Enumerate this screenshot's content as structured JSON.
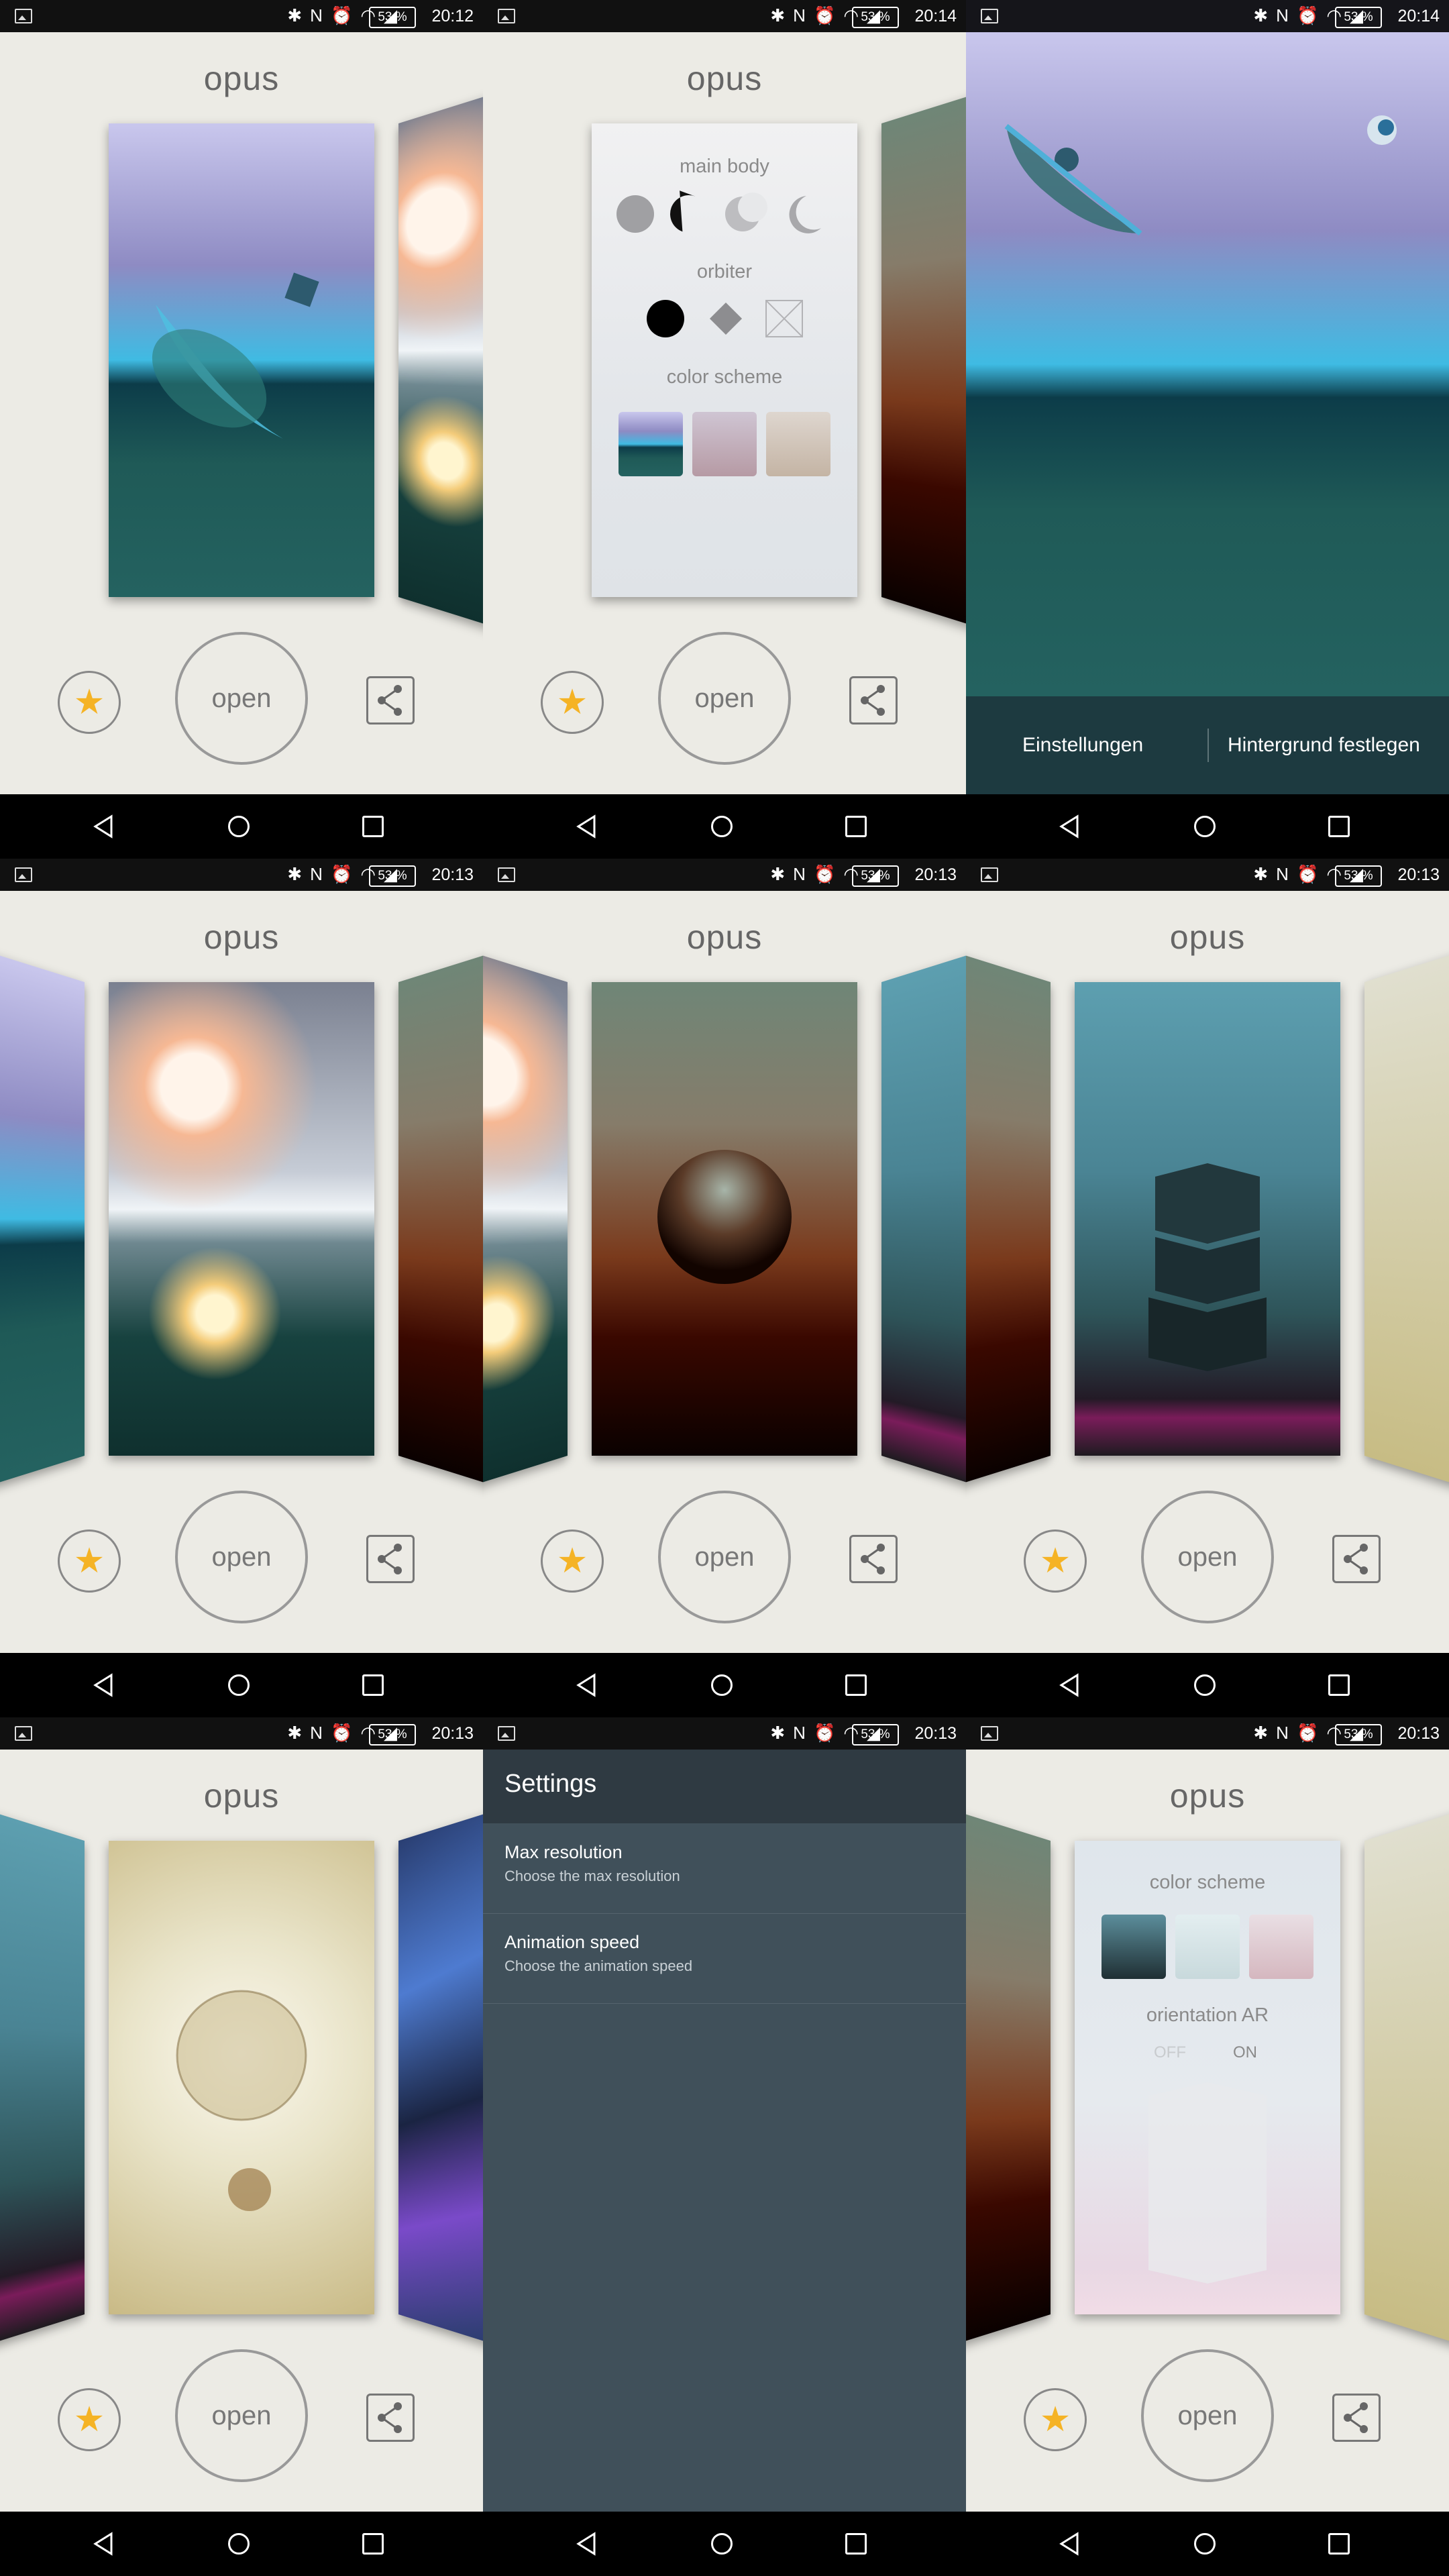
{
  "status": {
    "battery": "53 %",
    "times": [
      "20:12",
      "20:14",
      "20:14",
      "20:13",
      "20:13",
      "20:13",
      "20:13",
      "20:13",
      "20:13"
    ]
  },
  "app": {
    "title": "opus",
    "open_label": "open"
  },
  "options_panel": {
    "main_body": "main body",
    "orbiter": "orbiter",
    "color_scheme": "color scheme"
  },
  "options_panel2": {
    "color_scheme": "color scheme",
    "orientation": "orientation AR",
    "off": "OFF",
    "on": "ON"
  },
  "wallpaper_bar": {
    "settings": "Einstellungen",
    "set_wallpaper": "Hintergrund festlegen"
  },
  "settings": {
    "title": "Settings",
    "items": [
      {
        "title": "Max resolution",
        "subtitle": "Choose the max resolution"
      },
      {
        "title": "Animation speed",
        "subtitle": "Choose the animation speed"
      }
    ]
  },
  "colors": {
    "star": "#f5b325",
    "background": "#ecebe5",
    "settings_bg": "#40505a"
  }
}
